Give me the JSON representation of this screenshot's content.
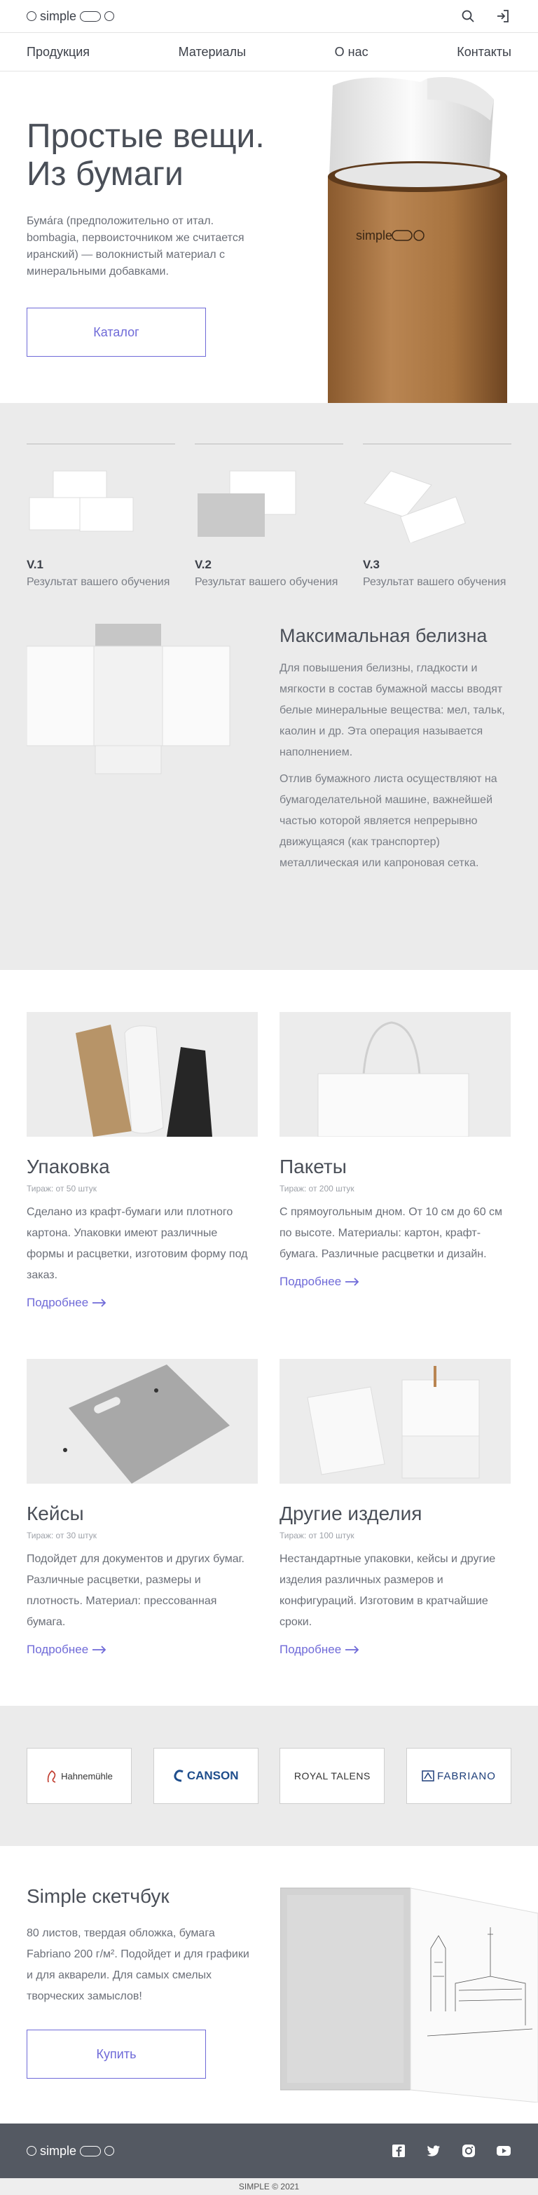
{
  "header": {
    "logo_text": "simple",
    "search_icon": "search-icon",
    "login_icon": "login-icon"
  },
  "nav": {
    "items": [
      "Продукция",
      "Материалы",
      "О нас",
      "Контакты"
    ]
  },
  "hero": {
    "title_line1": "Простые вещи.",
    "title_line2": "Из бумаги",
    "text": "Бума́га (предположительно от итал. bombagia, первоисточником же считается иранский) — волокнистый материал с минеральными добавками.",
    "button": "Каталог",
    "tube_logo": "simple"
  },
  "versions": [
    {
      "title": "V.1",
      "text": "Результат вашего обучения"
    },
    {
      "title": "V.2",
      "text": "Результат вашего обучения"
    },
    {
      "title": "V.3",
      "text": "Результат вашего обучения"
    }
  ],
  "whiteness": {
    "title": "Максимальная белизна",
    "p1": "Для повышения белизны, гладкости и мягкости в состав бумажной массы вводят белые минеральные вещества: мел, тальк, каолин и др. Эта операция называется наполнением.",
    "p2": "Отлив бумажного листа осуществляют на бумагоделательной машине, важнейшей частью которой является непрерывно движущаяся (как транспортер) металлическая или капроновая сетка."
  },
  "products": [
    {
      "title": "Упаковка",
      "tirage": "Тираж: от 50 штук",
      "desc": "Сделано из крафт-бумаги или плотного картона. Упаковки имеют различные формы и расцветки, изготовим форму под заказ.",
      "more": "Подробнее"
    },
    {
      "title": "Пакеты",
      "tirage": "Тираж: от 200 штук",
      "desc": "С прямоугольным дном. От 10 см до 60 см по высоте. Материалы: картон, крафт-бумага. Различные расцветки и дизайн.",
      "more": "Подробнее"
    },
    {
      "title": "Кейсы",
      "tirage": "Тираж: от 30 штук",
      "desc": "Подойдет для документов и других бумаг. Различные расцветки, размеры и плотность. Материал: прессованная бумага.",
      "more": "Подробнее"
    },
    {
      "title": "Другие изделия",
      "tirage": "Тираж: от 100 штук",
      "desc": "Нестандартные упаковки, кейсы и другие изделия различных размеров и конфигураций. Изготовим в кратчайшие сроки.",
      "more": "Подробнее"
    }
  ],
  "brands": [
    {
      "name": "Hahnemühle",
      "color": "#c0392b"
    },
    {
      "name": "CANSON",
      "color": "#1e4d8c"
    },
    {
      "name": "ROYAL TALENS",
      "color": "#c0392b"
    },
    {
      "name": "FABRIANO",
      "color": "#1e3f7a"
    }
  ],
  "sketchbook": {
    "title": "Simple скетчбук",
    "text": "80 листов, твердая обложка, бумага Fabriano 200 г/м². Подойдет и для графики и для акварели. Для самых смелых творческих замыслов!",
    "button": "Купить"
  },
  "footer": {
    "logo_text": "simple",
    "socials": [
      "facebook-icon",
      "twitter-icon",
      "instagram-icon",
      "youtube-icon"
    ],
    "copyright": "SIMPLE © 2021"
  },
  "colors": {
    "accent": "#6f6ad8",
    "footer_bg": "#545962",
    "grey_bg": "#ebebeb"
  }
}
